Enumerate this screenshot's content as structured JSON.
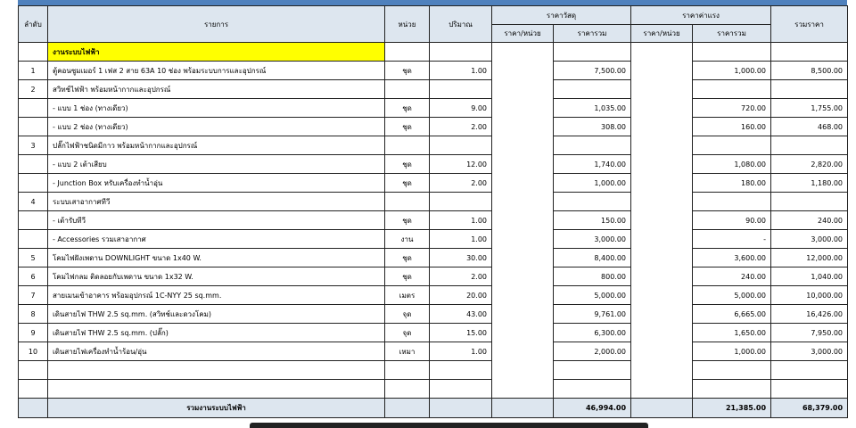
{
  "header": {
    "no": "ลำดับ",
    "item": "รายการ",
    "unit": "หน่วย",
    "qty": "ปริมาณ",
    "material": "ราคาวัสดุ",
    "labor": "ราคาค่าแรง",
    "total": "รวมราคา",
    "unit_price": "ราคา/หน่วย",
    "sum_price": "ราคารวม"
  },
  "section_title": "งานระบบไฟฟ้า",
  "rows": [
    {
      "no": "1",
      "item": "ตู้คอนซูมเมอร์ 1 เฟส 2 สาย 63A 10 ช่อง พร้อมระบบการและอุปกรณ์",
      "unit": "ชุด",
      "qty": "1.00",
      "mat_unit": "",
      "mat_sum": "7,500.00",
      "lab_unit": "",
      "lab_sum": "1,000.00",
      "total": "8,500.00"
    },
    {
      "no": "2",
      "item": "สวิทช์ไฟฟ้า พร้อมหน้ากากและอุปกรณ์",
      "unit": "",
      "qty": "",
      "mat_unit": "",
      "mat_sum": "",
      "lab_unit": "",
      "lab_sum": "",
      "total": ""
    },
    {
      "no": "",
      "item": "- แบบ 1 ช่อง (ทางเดียว)",
      "unit": "ชุด",
      "qty": "9.00",
      "mat_unit": "",
      "mat_sum": "1,035.00",
      "lab_unit": "",
      "lab_sum": "720.00",
      "total": "1,755.00"
    },
    {
      "no": "",
      "item": "- แบบ 2 ช่อง (ทางเดียว)",
      "unit": "ชุด",
      "qty": "2.00",
      "mat_unit": "",
      "mat_sum": "308.00",
      "lab_unit": "",
      "lab_sum": "160.00",
      "total": "468.00"
    },
    {
      "no": "3",
      "item": "ปลั๊กไฟฟ้าชนิดมีกาว พร้อมหน้ากากและอุปกรณ์",
      "unit": "",
      "qty": "",
      "mat_unit": "",
      "mat_sum": "",
      "lab_unit": "",
      "lab_sum": "",
      "total": ""
    },
    {
      "no": "",
      "item": "- แบบ 2 เต้าเสียบ",
      "unit": "ชุด",
      "qty": "12.00",
      "mat_unit": "",
      "mat_sum": "1,740.00",
      "lab_unit": "",
      "lab_sum": "1,080.00",
      "total": "2,820.00"
    },
    {
      "no": "",
      "item": "- Junction Box หรับเครื่องทำน้ำอุ่น",
      "unit": "ชุด",
      "qty": "2.00",
      "mat_unit": "",
      "mat_sum": "1,000.00",
      "lab_unit": "",
      "lab_sum": "180.00",
      "total": "1,180.00"
    },
    {
      "no": "4",
      "item": "ระบบเสาอากาศทีวี",
      "unit": "",
      "qty": "",
      "mat_unit": "",
      "mat_sum": "",
      "lab_unit": "",
      "lab_sum": "",
      "total": ""
    },
    {
      "no": "",
      "item": "- เต้ารับทีวี",
      "unit": "ชุด",
      "qty": "1.00",
      "mat_unit": "",
      "mat_sum": "150.00",
      "lab_unit": "",
      "lab_sum": "90.00",
      "total": "240.00"
    },
    {
      "no": "",
      "item": "- Accessories รวมเสาอากาศ",
      "unit": "งาน",
      "qty": "1.00",
      "mat_unit": "",
      "mat_sum": "3,000.00",
      "lab_unit": "",
      "lab_sum": "-",
      "total": "3,000.00"
    },
    {
      "no": "5",
      "item": "โคมไฟฝังเพดาน DOWNLIGHT ขนาด 1x40 W.",
      "unit": "ชุด",
      "qty": "30.00",
      "mat_unit": "",
      "mat_sum": "8,400.00",
      "lab_unit": "",
      "lab_sum": "3,600.00",
      "total": "12,000.00"
    },
    {
      "no": "6",
      "item": "โคมไฟกลม ติดลอยกับเพดาน ขนาด 1x32 W.",
      "unit": "ชุด",
      "qty": "2.00",
      "mat_unit": "",
      "mat_sum": "800.00",
      "lab_unit": "",
      "lab_sum": "240.00",
      "total": "1,040.00"
    },
    {
      "no": "7",
      "item": "สายเมนเข้าอาคาร พร้อมอุปกรณ์ 1C-NYY 25 sq.mm.",
      "unit": "เมตร",
      "qty": "20.00",
      "mat_unit": "",
      "mat_sum": "5,000.00",
      "lab_unit": "",
      "lab_sum": "5,000.00",
      "total": "10,000.00"
    },
    {
      "no": "8",
      "item": "เดินสายไฟ THW 2.5 sq.mm. (สวิทช์และดวงโคม)",
      "unit": "จุด",
      "qty": "43.00",
      "mat_unit": "",
      "mat_sum": "9,761.00",
      "lab_unit": "",
      "lab_sum": "6,665.00",
      "total": "16,426.00"
    },
    {
      "no": "9",
      "item": "เดินสายไฟ THW 2.5 sq.mm. (ปลั๊ก)",
      "unit": "จุด",
      "qty": "15.00",
      "mat_unit": "",
      "mat_sum": "6,300.00",
      "lab_unit": "",
      "lab_sum": "1,650.00",
      "total": "7,950.00"
    },
    {
      "no": "10",
      "item": "เดินสายไฟเครื่องทำน้ำร้อน/อุ่น",
      "unit": "เหมา",
      "qty": "1.00",
      "mat_unit": "",
      "mat_sum": "2,000.00",
      "lab_unit": "",
      "lab_sum": "1,000.00",
      "total": "3,000.00"
    },
    {
      "no": "",
      "item": "",
      "unit": "",
      "qty": "",
      "mat_unit": "",
      "mat_sum": "",
      "lab_unit": "",
      "lab_sum": "",
      "total": ""
    },
    {
      "no": "",
      "item": "",
      "unit": "",
      "qty": "",
      "mat_unit": "",
      "mat_sum": "",
      "lab_unit": "",
      "lab_sum": "",
      "total": ""
    }
  ],
  "total_row": {
    "label": "รวมงานระบบไฟฟ้า",
    "mat_sum": "46,994.00",
    "lab_sum": "21,385.00",
    "total": "68,379.00"
  },
  "colors": {
    "header_bg": "#dde6ef",
    "highlight": "#ffff00",
    "top_bar": "#4f81bd"
  }
}
